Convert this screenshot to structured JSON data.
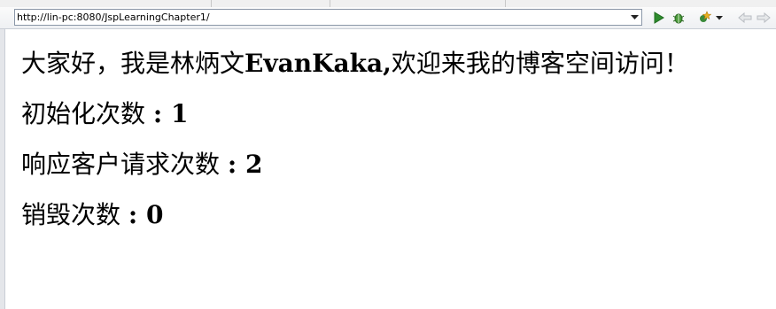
{
  "browser": {
    "url": "http://lin-pc:8080/JspLearningChapter1/",
    "icons": {
      "dropdown": "chevron-down-icon",
      "run": "run-icon",
      "debug": "debug-icon",
      "tools": "external-tools-icon",
      "back": "back-arrow-icon",
      "forward": "forward-arrow-icon"
    }
  },
  "page": {
    "greeting_pre": "大家好，我是林炳文",
    "greeting_name": "EvanKaka,",
    "greeting_post": "欢迎来我的博客空间访问！",
    "init_label": "初始化次数 ",
    "init_value": ": 1",
    "service_label": "响应客户请求次数 ",
    "service_value": ": 2",
    "destroy_label": "销毁次数 ",
    "destroy_value": ": 0"
  },
  "colors": {
    "run_green": "#2e8b2e",
    "toolbar_bg": "#eef0f3",
    "url_border": "#8b97a8"
  }
}
